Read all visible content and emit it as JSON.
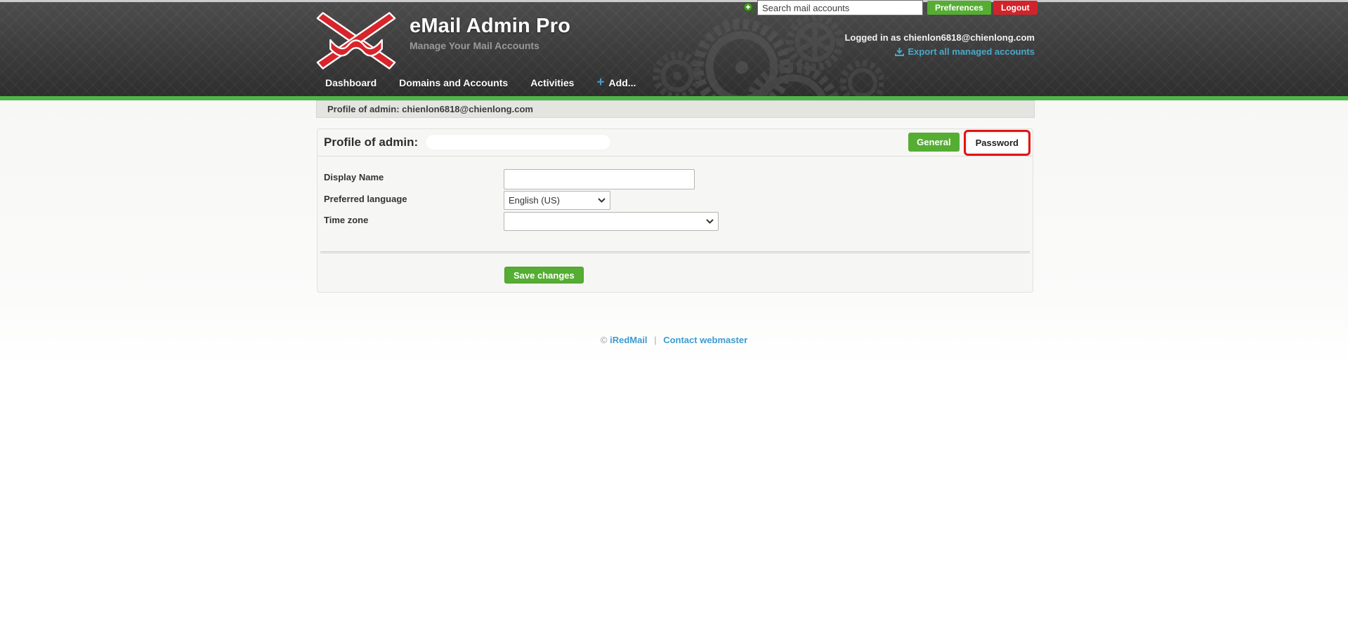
{
  "topbar": {
    "search_placeholder": "Search mail accounts",
    "preferences_label": "Preferences",
    "logout_label": "Logout"
  },
  "brand": {
    "title": "eMail Admin Pro",
    "subtitle": "Manage Your Mail Accounts"
  },
  "session": {
    "logged_in_text": "Logged in as chienlon6818@chienlong.com",
    "export_link_label": "Export all managed accounts"
  },
  "nav": {
    "items": [
      {
        "label": "Dashboard"
      },
      {
        "label": "Domains and Accounts"
      },
      {
        "label": "Activities"
      },
      {
        "label": "Add..."
      }
    ]
  },
  "breadcrumb": {
    "text": "Profile of admin: chienlon6818@chienlong.com"
  },
  "profile": {
    "title": "Profile of admin:",
    "tabs": [
      {
        "label": "General",
        "state": "active"
      },
      {
        "label": "Password",
        "state": "highlighted"
      }
    ],
    "fields": [
      {
        "label": "Display Name",
        "type": "text",
        "value": ""
      },
      {
        "label": "Preferred language",
        "type": "select",
        "value": "English (US)"
      },
      {
        "label": "Time zone",
        "type": "select",
        "value": ""
      }
    ],
    "save_label": "Save changes"
  },
  "footer": {
    "copyright_symbol": "©",
    "brand_link": "iRedMail",
    "separator": "|",
    "contact_link": "Contact webmaster"
  },
  "colors": {
    "header_dark": "#3a3a3a",
    "green_accent_line": "#4eb648",
    "button_green": "#55ad33",
    "logout_red": "#d2232a",
    "highlight_red": "#e31212",
    "footer_link_blue": "#3d9bd1",
    "export_link_teal": "#4aa8c9",
    "logo_red": "#d8242b"
  }
}
